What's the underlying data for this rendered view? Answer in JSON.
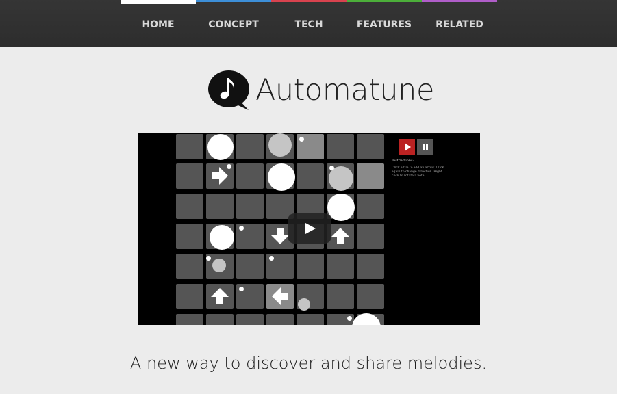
{
  "nav": {
    "items": [
      {
        "label": "HOME",
        "color": "#ffffff",
        "active": true
      },
      {
        "label": "CONCEPT",
        "color": "#3d8fd8"
      },
      {
        "label": "TECH",
        "color": "#d9434f"
      },
      {
        "label": "FEATURES",
        "color": "#4caf3a"
      },
      {
        "label": "RELATED",
        "color": "#b05ec9"
      }
    ]
  },
  "logo": {
    "text": "Automatune",
    "icon": "music-note-speech-bubble-icon"
  },
  "video": {
    "instructions_title": "Instructions:",
    "instructions_text": "Click a tile to add an arrow. Click again to change direction. Right click to rotate a note.",
    "play_icon": "play-icon",
    "pause_icon": "pause-icon"
  },
  "tagline": "A new way to discover and share melodies.",
  "colors": {
    "nav_bg": "#2f2f2f",
    "page_bg": "#ececec",
    "text": "#1e1e1e"
  }
}
